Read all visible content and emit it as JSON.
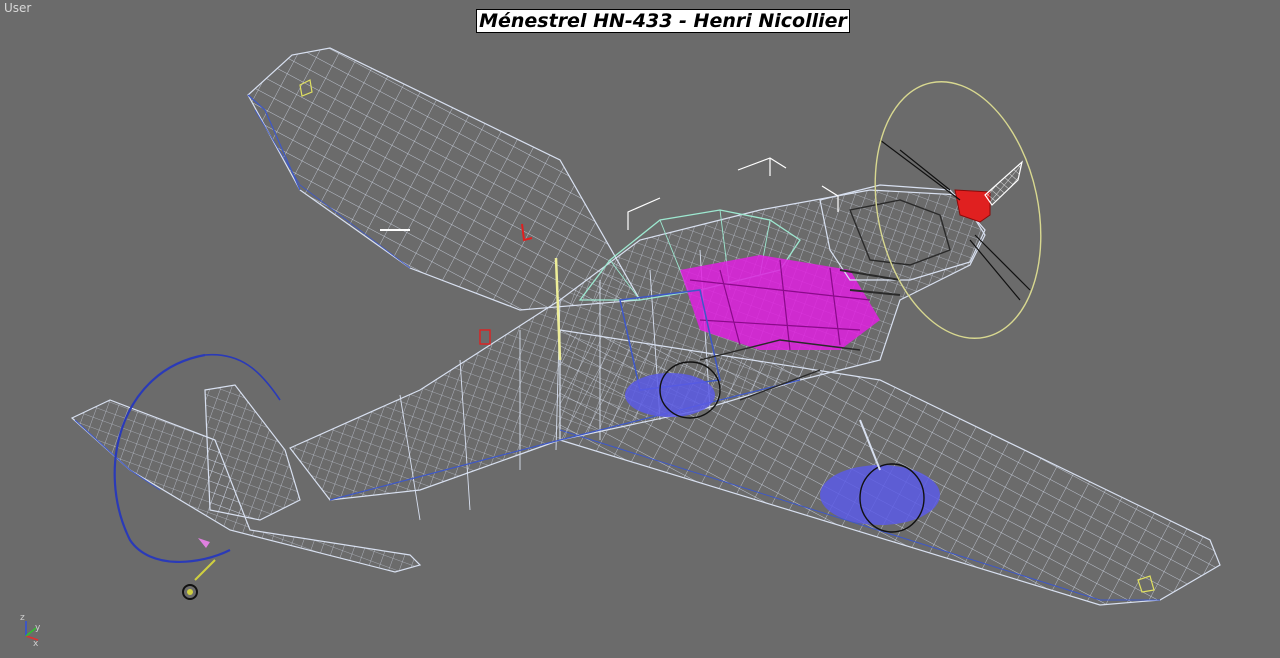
{
  "viewport": {
    "label": "User",
    "title": "Ménestrel HN-433 - Henri Nicollier",
    "background": "#6b6b6b"
  },
  "axis_gizmo": {
    "x_label": "x",
    "y_label": "y",
    "z_label": "z",
    "x_color": "#e03030",
    "y_color": "#30c030",
    "z_color": "#3050e0"
  },
  "colors": {
    "wire_white": "#d8e0f0",
    "wire_blue": "#3e58c8",
    "highlight_magenta": "#e020e0",
    "highlight_blue": "#5a5ae6",
    "prop_ring": "#d8d890",
    "spinner_red": "#e02020"
  }
}
